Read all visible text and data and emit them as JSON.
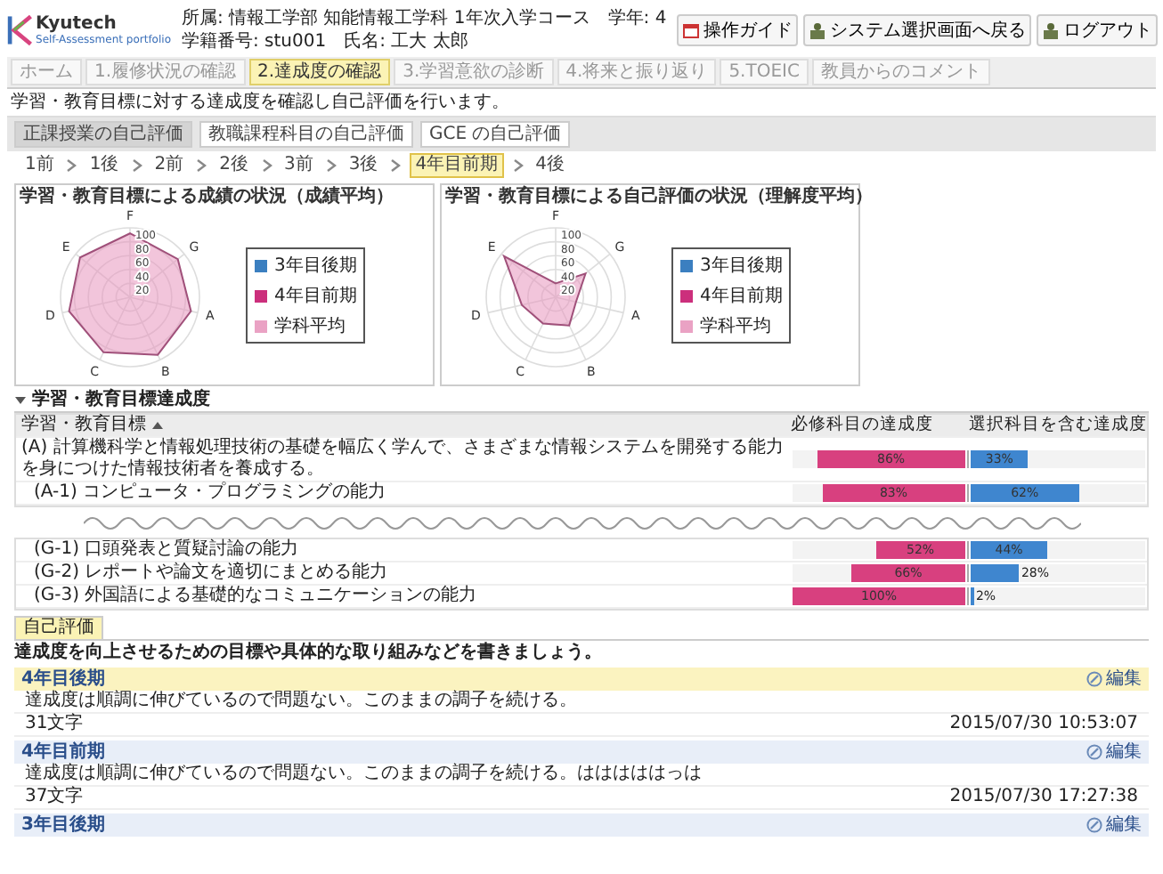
{
  "header": {
    "logo": {
      "name": "Kyutech",
      "tagline": "Self-Assessment portfolio"
    },
    "affiliation": "所属: 情報工学部 知能情報工学科 1年次入学コース",
    "grade": "学年: 4",
    "student_id": "学籍番号: stu001",
    "student_name": "氏名: 工大 太郎",
    "buttons": [
      {
        "label": "操作ガイド",
        "kind": "guide"
      },
      {
        "label": "システム選択画面へ戻る",
        "kind": "system"
      },
      {
        "label": "ログアウト",
        "kind": "system"
      }
    ]
  },
  "nav_tabs": [
    {
      "label": "ホーム",
      "selected": false
    },
    {
      "label": "1.履修状況の確認",
      "selected": false
    },
    {
      "label": "2.達成度の確認",
      "selected": true
    },
    {
      "label": "3.学習意欲の診断",
      "selected": false
    },
    {
      "label": "4.将来と振り返り",
      "selected": false
    },
    {
      "label": "5.TOEIC",
      "selected": false
    },
    {
      "label": "教員からのコメント",
      "selected": false
    }
  ],
  "description": "学習・教育目標に対する達成度を確認し自己評価を行います。",
  "sub_tabs": [
    {
      "label": "正課授業の自己評価",
      "selected": true
    },
    {
      "label": "教職課程科目の自己評価",
      "selected": false
    },
    {
      "label": "GCE の自己評価",
      "selected": false
    }
  ],
  "breadcrumb": [
    {
      "label": "1前",
      "selected": false
    },
    {
      "label": "1後",
      "selected": false
    },
    {
      "label": "2前",
      "selected": false
    },
    {
      "label": "2後",
      "selected": false
    },
    {
      "label": "3前",
      "selected": false
    },
    {
      "label": "3後",
      "selected": false
    },
    {
      "label": "4年目前期",
      "selected": true
    },
    {
      "label": "4後",
      "selected": false
    }
  ],
  "charts": [
    {
      "title": "学習・教育目標による成績の状況（成績平均）",
      "axes": [
        "F",
        "G",
        "A",
        "B",
        "C",
        "D",
        "E"
      ],
      "ticks": [
        "100",
        "80",
        "60",
        "40",
        "20"
      ],
      "legend": [
        {
          "label": "3年目後期",
          "color": "#3b7fc0"
        },
        {
          "label": "4年目前期",
          "color": "#cc2f7c"
        },
        {
          "label": "学科平均",
          "color": "#eaa2c4"
        }
      ]
    },
    {
      "title": "学習・教育目標による自己評価の状況（理解度平均）",
      "axes": [
        "F",
        "G",
        "A",
        "B",
        "C",
        "D",
        "E"
      ],
      "ticks": [
        "100",
        "80",
        "60",
        "40",
        "20"
      ],
      "legend": [
        {
          "label": "3年目後期",
          "color": "#3b7fc0"
        },
        {
          "label": "4年目前期",
          "color": "#cc2f7c"
        },
        {
          "label": "学科平均",
          "color": "#eaa2c4"
        }
      ]
    }
  ],
  "goals": {
    "title": "学習・教育目標達成度",
    "columns": [
      "学習・教育目標",
      "必修科目の達成度",
      "選択科目を含む達成度"
    ],
    "rows": [
      {
        "label": "(A) 計算機科学と情報処理技術の基礎を幅広く学んで、さまざまな情報システムを開発する能力を身につけた情報技術者を養成する。",
        "required": {
          "level": 0.86,
          "reading": "86%"
        },
        "elective": {
          "level": 0.33,
          "reading": "33%"
        },
        "children": [
          {
            "label": "(A-1) コンピュータ・プログラミングの能力",
            "required": {
              "level": 0.83,
              "reading": "83%"
            },
            "elective": {
              "level": 0.62,
              "reading": "62%"
            }
          }
        ]
      }
    ],
    "rows_after_break": [
      {
        "label": "(G-1) 口頭発表と質疑討論の能力",
        "required": {
          "level": 0.52,
          "reading": "52%"
        },
        "elective": {
          "level": 0.44,
          "reading": "44%"
        }
      },
      {
        "label": "(G-2) レポートや論文を適切にまとめる能力",
        "required": {
          "level": 0.66,
          "reading": "66%"
        },
        "elective": {
          "level": 0.28,
          "reading": "28%"
        }
      },
      {
        "label": "(G-3) 外国語による基礎的なコミュニケーションの能力",
        "required": {
          "level": 1.0,
          "reading": "100%"
        },
        "elective": {
          "level": 0.02,
          "reading": "2%"
        }
      }
    ]
  },
  "self_eval": {
    "tab": "自己評価",
    "instruction": "達成度を向上させるための目標や具体的な取り組みなどを書きましょう。",
    "entries": [
      {
        "term": "4年目後期",
        "selected": true,
        "edit": "編集",
        "comment": "達成度は順調に伸びているので問題ない。このままの調子を続ける。",
        "count": "31文字",
        "date": "2015/07/30 10:53:07"
      },
      {
        "term": "4年目前期",
        "selected": false,
        "edit": "編集",
        "comment": "達成度は順調に伸びているので問題ない。このままの調子を続ける。はははははっは",
        "count": "37文字",
        "date": "2015/07/30 17:27:38"
      },
      {
        "term": "3年目後期",
        "selected": false,
        "edit": "編集"
      }
    ]
  }
}
